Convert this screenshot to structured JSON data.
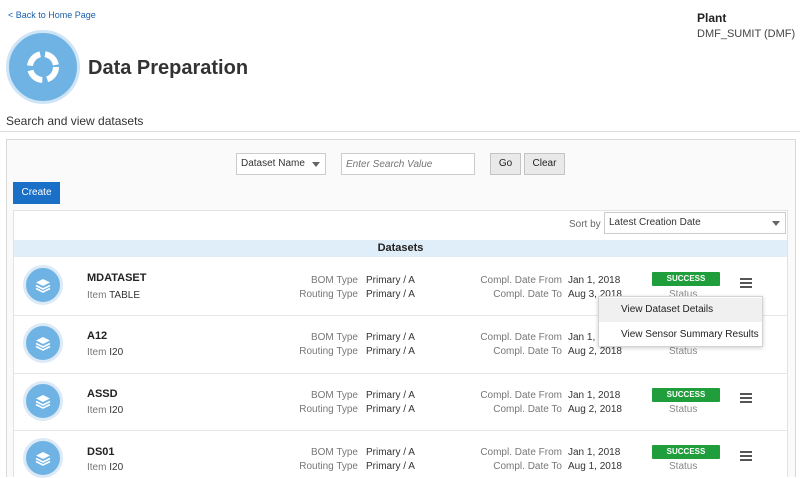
{
  "nav": {
    "back_label": "< Back to Home Page"
  },
  "plant": {
    "label": "Plant",
    "value": "DMF_SUMIT (DMF)"
  },
  "page": {
    "title": "Data Preparation",
    "subtitle": "Search and view datasets"
  },
  "search": {
    "field_selected": "Dataset Name",
    "placeholder": "Enter Search Value",
    "go_label": "Go",
    "clear_label": "Clear"
  },
  "create_label": "Create",
  "sort": {
    "label": "Sort by",
    "selected": "Latest Creation Date"
  },
  "list_title": "Datasets",
  "labels": {
    "item": "Item",
    "bom_type": "BOM Type",
    "routing_type": "Routing Type",
    "compl_from": "Compl. Date From",
    "compl_to": "Compl. Date To",
    "status": "Status"
  },
  "datasets": [
    {
      "name": "MDATASET",
      "item": "TABLE",
      "bom_type": "Primary / A",
      "routing_type": "Primary / A",
      "date_from": "Jan 1, 2018",
      "date_to": "Aug 3, 2018",
      "status": "SUCCESS"
    },
    {
      "name": "A12",
      "item": "I20",
      "bom_type": "Primary / A",
      "routing_type": "Primary / A",
      "date_from": "Jan 1, 2",
      "date_to": "Aug 2, 2018",
      "status": "SUCCESS"
    },
    {
      "name": "ASSD",
      "item": "I20",
      "bom_type": "Primary / A",
      "routing_type": "Primary / A",
      "date_from": "Jan 1, 2018",
      "date_to": "Aug 2, 2018",
      "status": "SUCCESS"
    },
    {
      "name": "DS01",
      "item": "I20",
      "bom_type": "Primary / A",
      "routing_type": "Primary / A",
      "date_from": "Jan 1, 2018",
      "date_to": "Aug 1, 2018",
      "status": "SUCCESS"
    }
  ],
  "context_menu": {
    "items": [
      "View Dataset Details",
      "View Sensor Summary Results"
    ]
  },
  "colors": {
    "accent": "#1a6fc6",
    "icon_blue": "#6fb3e4",
    "success": "#1f9e3b",
    "header_band": "#dfeef9"
  },
  "icons": {
    "page": "cycle-arrows-icon",
    "row": "layers-stack-icon",
    "row_menu": "hamburger-menu-icon"
  }
}
